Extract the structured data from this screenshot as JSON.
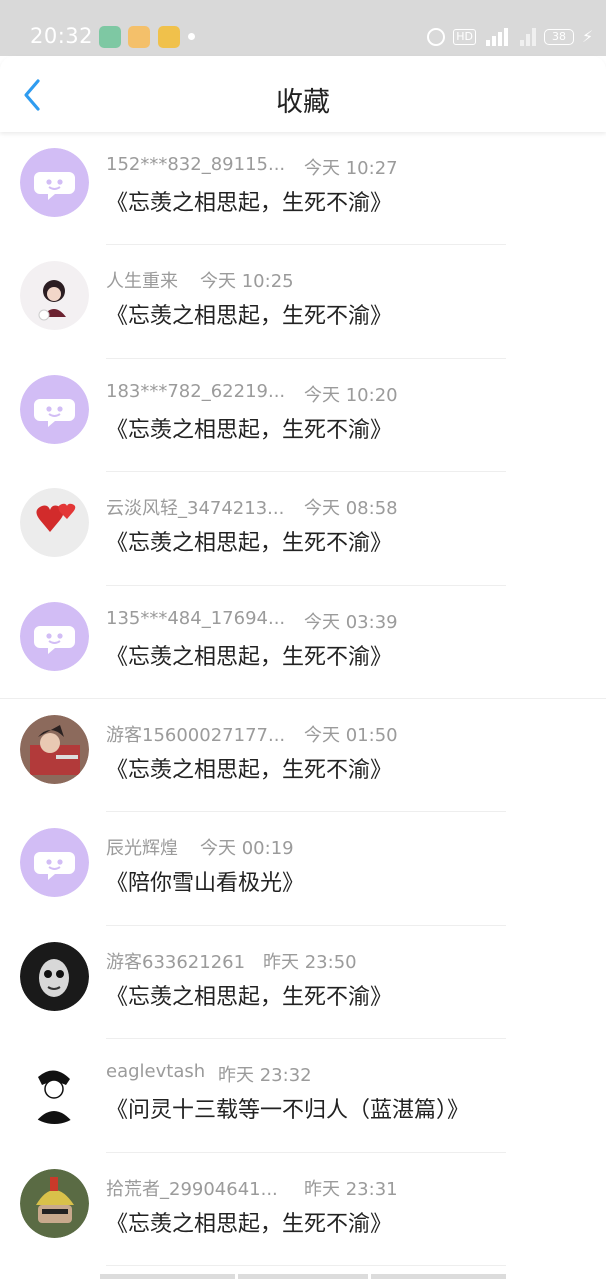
{
  "status_bar": {
    "time": "20:32",
    "hd": "HD",
    "battery": "38"
  },
  "header": {
    "title": "收藏"
  },
  "colors": {
    "accent": "#2f9cf0",
    "avatar_default_bg": "#d2bdf5"
  },
  "items": [
    {
      "name": "152***832_89115...",
      "time": "今天 10:27",
      "song": "《忘羡之相思起，生死不渝》",
      "avatar": "default-chat-avatar"
    },
    {
      "name": "人生重来",
      "time": "今天 10:25",
      "song": "《忘羡之相思起，生死不渝》",
      "avatar": "anime-avatar"
    },
    {
      "name": "183***782_62219...",
      "time": "今天 10:20",
      "song": "《忘羡之相思起，生死不渝》",
      "avatar": "default-chat-avatar"
    },
    {
      "name": "云淡风轻_3474213...",
      "time": "今天 08:58",
      "song": "《忘羡之相思起，生死不渝》",
      "avatar": "hearts-avatar"
    },
    {
      "name": "135***484_17694...",
      "time": "今天 03:39",
      "song": "《忘羡之相思起，生死不渝》",
      "avatar": "default-chat-avatar"
    },
    {
      "name": "游客15600027177...",
      "time": "今天 01:50",
      "song": "《忘羡之相思起，生死不渝》",
      "avatar": "warrior-avatar"
    },
    {
      "name": "辰光辉煌",
      "time": "今天 00:19",
      "song": "《陪你雪山看极光》",
      "avatar": "default-chat-avatar"
    },
    {
      "name": "游客633621261",
      "time": "昨天 23:50",
      "song": "《忘羡之相思起，生死不渝》",
      "avatar": "monochrome-face-avatar"
    },
    {
      "name": "eaglevtash",
      "time": "昨天 23:32",
      "song": "《问灵十三载等一不归人（蓝湛篇）》",
      "avatar": "sketch-avatar"
    },
    {
      "name": "拾荒者_29904641...",
      "time": "昨天 23:31",
      "song": "《忘羡之相思起，生死不渝》",
      "avatar": "helmet-avatar"
    }
  ]
}
